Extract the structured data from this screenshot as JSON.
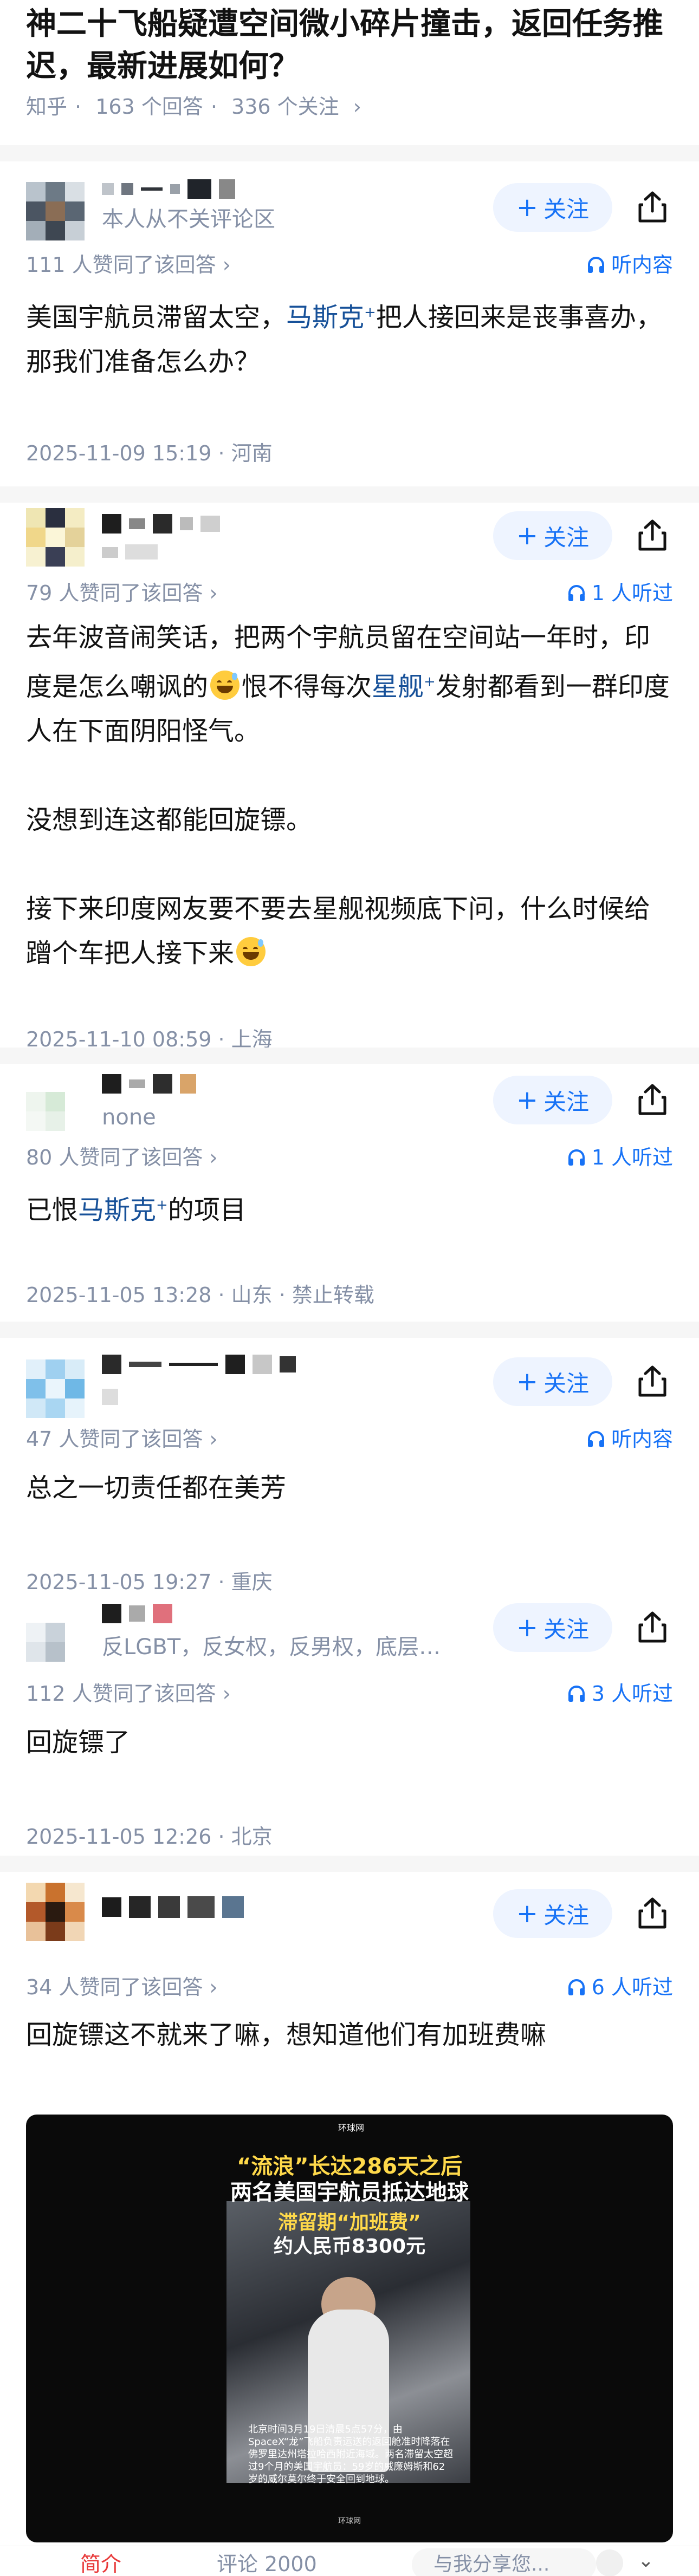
{
  "question": {
    "title": "神二十飞船疑遭空间微小碎片撞击，返回任务推迟，最新进展如何？",
    "source": "知乎",
    "dot": "·",
    "answers": "163 个回答",
    "followers": "336 个关注",
    "chevron": "›"
  },
  "ui": {
    "follow_label": "关注",
    "follow_plus": "+",
    "vote_chevron": "›",
    "share_icon": "share-icon",
    "listen_icon": "headphones-icon"
  },
  "answers": [
    {
      "bio": "本人从不关评论区",
      "votes": "111 人赞同了该回答",
      "listen": "听内容",
      "body": [
        [
          {
            "t": "美国宇航员滞留太空，"
          },
          {
            "link": "马斯克"
          },
          {
            "t": "把人接回来是丧事喜办，那我们准备怎么办？"
          }
        ]
      ],
      "date": "2025-11-09 15:19 · 河南"
    },
    {
      "bio": "",
      "votes": "79 人赞同了该回答",
      "listen": "1 人听过",
      "body": [
        [
          {
            "t": "去年波音闹笑话，把两个宇航员留在空间站一年时，印度是怎么嘲讽的"
          },
          {
            "emoji": "grin-sweat"
          },
          {
            "t": "恨不得每次"
          },
          {
            "link": "星舰"
          },
          {
            "t": "发射都看到一群印度人在下面阴阳怪气。"
          }
        ],
        [],
        [
          {
            "t": "没想到连这都能回旋镖。"
          }
        ],
        [],
        [
          {
            "t": "接下来印度网友要不要去星舰视频底下问，什么时候给蹭个车把人接下来"
          },
          {
            "emoji": "grin-sweat"
          }
        ]
      ],
      "date": "2025-11-10 08:59 · 上海"
    },
    {
      "bio": "none",
      "votes": "80 人赞同了该回答",
      "listen": "1 人听过",
      "body": [
        [
          {
            "t": "已恨"
          },
          {
            "link": "马斯克"
          },
          {
            "t": "的项目"
          }
        ]
      ],
      "date": "2025-11-05 13:28 · 山东 · 禁止转载"
    },
    {
      "bio": "",
      "votes": "47 人赞同了该回答",
      "listen": "听内容",
      "body": [
        [
          {
            "t": "总之一切责任都在美芳"
          }
        ]
      ],
      "date": "2025-11-05 19:27 · 重庆"
    },
    {
      "bio": "反LGBT，反女权，反男权，底层…",
      "votes": "112 人赞同了该回答",
      "listen": "3 人听过",
      "body": [
        [
          {
            "t": "回旋镖了"
          }
        ]
      ],
      "date": "2025-11-05 12:26 · 北京"
    },
    {
      "bio": "",
      "votes": "34 人赞同了该回答",
      "listen": "6 人听过",
      "body": [
        [
          {
            "t": "回旋镖这不就来了嘛，想知道他们有加班费嘛"
          }
        ]
      ],
      "date": ""
    }
  ],
  "image_card": {
    "logo": "环球网",
    "line1": "“流浪”长达286天之后",
    "line2": "两名美国宇航员抵达地球",
    "line3": "滞留期“加班费”",
    "line4": "约人民币8300元",
    "caption": "北京时间3月19日清晨5点57分，由SpaceX“龙”飞船负责运送的返回舱准时降落在佛罗里达州塔拉哈西附近海域。两名滞留太空超过9个月的美国宇航员：59岁的威廉姆斯和62岁的威尔莫尔终于安全回到地球。",
    "mark": "环球网"
  },
  "bottom_bar": {
    "tab1": "简介",
    "tab2": "评论 2000",
    "reply": "与我分享您..."
  }
}
